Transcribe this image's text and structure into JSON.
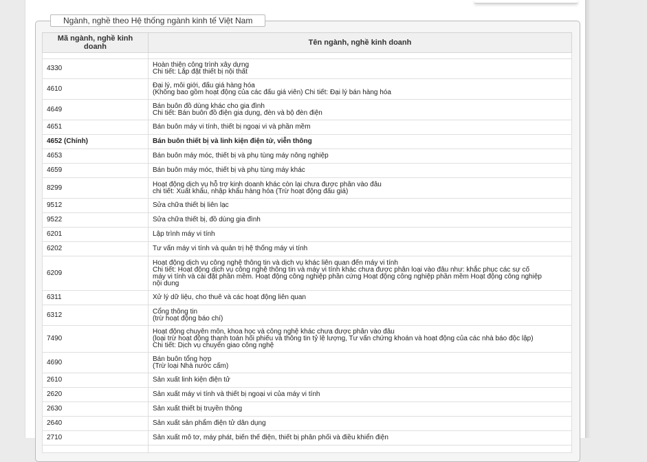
{
  "section_title": "Ngành, nghề theo Hệ thống ngành kinh tế Việt Nam",
  "table": {
    "headers": {
      "code": "Mã ngành, nghề kinh doanh",
      "name": "Tên ngành, nghề kinh doanh"
    },
    "rows": [
      {
        "code": "4330",
        "lines": [
          "Hoàn thiện công trình xây dựng",
          "Chi tiết: Lắp đặt thiết bị nội thất"
        ]
      },
      {
        "code": "4610",
        "lines": [
          "Đại lý, môi giới, đấu giá hàng hóa",
          "(Không bao gồm hoạt động của các đấu giá viên) Chi tiết: Đại lý bán hàng hóa"
        ]
      },
      {
        "code": "4649",
        "lines": [
          "Bán buôn đồ dùng khác cho gia đình",
          "Chi tiết: Bán buôn đồ điện gia dụng, đèn và bộ đèn điện"
        ]
      },
      {
        "code": "4651",
        "lines": [
          "Bán buôn máy vi tính, thiết bị ngoại vi và phần mềm"
        ]
      },
      {
        "code": "4652 (Chính)",
        "lines": [
          "Bán buôn thiết bị và linh kiện điện tử, viễn thông"
        ],
        "main": true
      },
      {
        "code": "4653",
        "lines": [
          "Bán buôn máy móc, thiết bị và phụ tùng máy nông nghiệp"
        ]
      },
      {
        "code": "4659",
        "lines": [
          "Bán buôn máy móc, thiết bị và phụ tùng máy khác"
        ]
      },
      {
        "code": "8299",
        "lines": [
          "Hoạt động dịch vụ hỗ trợ kinh doanh khác còn lại chưa được phân vào đâu",
          "chi tiết: Xuất khẩu, nhập khẩu hàng hóa (Trừ hoạt động đấu giá)"
        ]
      },
      {
        "code": "9512",
        "lines": [
          "Sửa chữa thiết bị liên lạc"
        ]
      },
      {
        "code": "9522",
        "lines": [
          "Sửa chữa thiết bị, đồ dùng gia đình"
        ]
      },
      {
        "code": "6201",
        "lines": [
          "Lập trình máy vi tính"
        ]
      },
      {
        "code": "6202",
        "lines": [
          "Tư vấn máy vi tính và quản trị hệ thống máy vi tính"
        ]
      },
      {
        "code": "6209",
        "lines": [
          "Hoạt động dịch vụ công nghệ thông tin và dịch vụ khác liên quan đến máy vi tính",
          "Chi tiết: Hoạt động dịch vụ công nghệ thông tin và máy vi tính khác chưa được phân loại vào đâu như: khắc phục các sự cố",
          "máy vi tính và cài đặt phần mềm. Hoạt động công nghiệp phần cứng Hoạt động công nghiệp phần mềm Hoạt động công nghiệp",
          "nội dung"
        ]
      },
      {
        "code": "6311",
        "lines": [
          "Xử lý dữ liệu, cho thuê và các hoạt động liên quan"
        ]
      },
      {
        "code": "6312",
        "lines": [
          "Cổng thông tin",
          "(trừ hoạt động báo chí)"
        ]
      },
      {
        "code": "7490",
        "lines": [
          "Hoạt động chuyên môn, khoa học và công nghệ khác chưa được phân vào đâu",
          "(loại trừ hoạt động thanh toán hối phiếu và thông tin tỷ lệ lượng, Tư vấn chứng khoán và hoạt động của các nhà báo độc lập)",
          "Chi tiết: Dịch vụ chuyển giao công nghệ"
        ]
      },
      {
        "code": "4690",
        "lines": [
          "Bán buôn tổng hợp",
          "(Trừ loại Nhà nước cấm)"
        ]
      },
      {
        "code": "2610",
        "lines": [
          "Sản xuất linh kiện điện tử"
        ]
      },
      {
        "code": "2620",
        "lines": [
          "Sản xuất máy vi tính và thiết bị ngoại vi của máy vi tính"
        ]
      },
      {
        "code": "2630",
        "lines": [
          "Sản xuất thiết bị truyền thông"
        ]
      },
      {
        "code": "2640",
        "lines": [
          "Sản xuất sản phẩm điện tử dân dụng"
        ]
      },
      {
        "code": "2710",
        "lines": [
          "Sản xuất mô tơ, máy phát, biến thế điện, thiết bị phân phối và điều khiển điện"
        ]
      },
      {
        "code": "",
        "lines": [
          ""
        ]
      }
    ]
  }
}
